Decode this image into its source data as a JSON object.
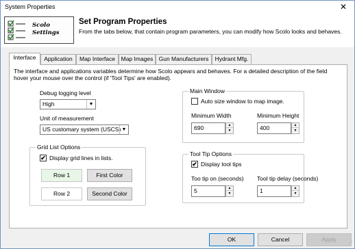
{
  "window": {
    "title": "System Properties",
    "close_label": "✕"
  },
  "header": {
    "logo_line1": "Scolo",
    "logo_line2": "Settings",
    "title": "Set Program Properties",
    "description": "From the tabs below, that contain program parameters, you can modify how Scolo looks and behaves."
  },
  "tabs": [
    {
      "label": "Interface",
      "active": true
    },
    {
      "label": "Application"
    },
    {
      "label": "Map Interface"
    },
    {
      "label": "Map Images"
    },
    {
      "label": "Gun Manufacturers"
    },
    {
      "label": "Hydrant Mfg."
    }
  ],
  "interface": {
    "intro": "The interface and applications variables determine how Scolo appears and behaves.  For a detailed description of the field hover your mouse over the control (if 'Tool Tips' are enabled).",
    "debug_label": "Debug logging level",
    "debug_value": "High",
    "unit_label": "Unit of measurement",
    "unit_value": "US customary system (USCS)",
    "grid_title": "Grid List Options",
    "grid_lines_label": "Display grid lines in lists.",
    "grid_lines_checked": true,
    "row1_label": "Row 1",
    "row2_label": "Row 2",
    "first_color_label": "First Color",
    "second_color_label": "Second Color",
    "row1_color": "#e8f6e8",
    "row2_color": "#ffffff",
    "main_window_title": "Main Window",
    "auto_size_label": "Auto size window to map image.",
    "auto_size_checked": false,
    "min_width_label": "Minimum Width",
    "min_width_value": "690",
    "min_height_label": "Minimum Height",
    "min_height_value": "400",
    "tooltip_title": "Tool Tip Options",
    "display_tooltips_label": "Display tool tips",
    "display_tooltips_checked": true,
    "tooltip_on_label": "Too tip on (seconds)",
    "tooltip_on_value": "5",
    "tooltip_delay_label": "Tool tip delay (seconds)",
    "tooltip_delay_value": "1"
  },
  "footer": {
    "ok_label": "OK",
    "cancel_label": "Cancel",
    "apply_label": "Apply"
  },
  "glyphs": {
    "check": "✔",
    "combo_arrow": "▼",
    "spin_up": "▲",
    "spin_down": "▼"
  },
  "colors": {
    "accent_border": "#0078d7",
    "window_border": "#6e93c7"
  }
}
